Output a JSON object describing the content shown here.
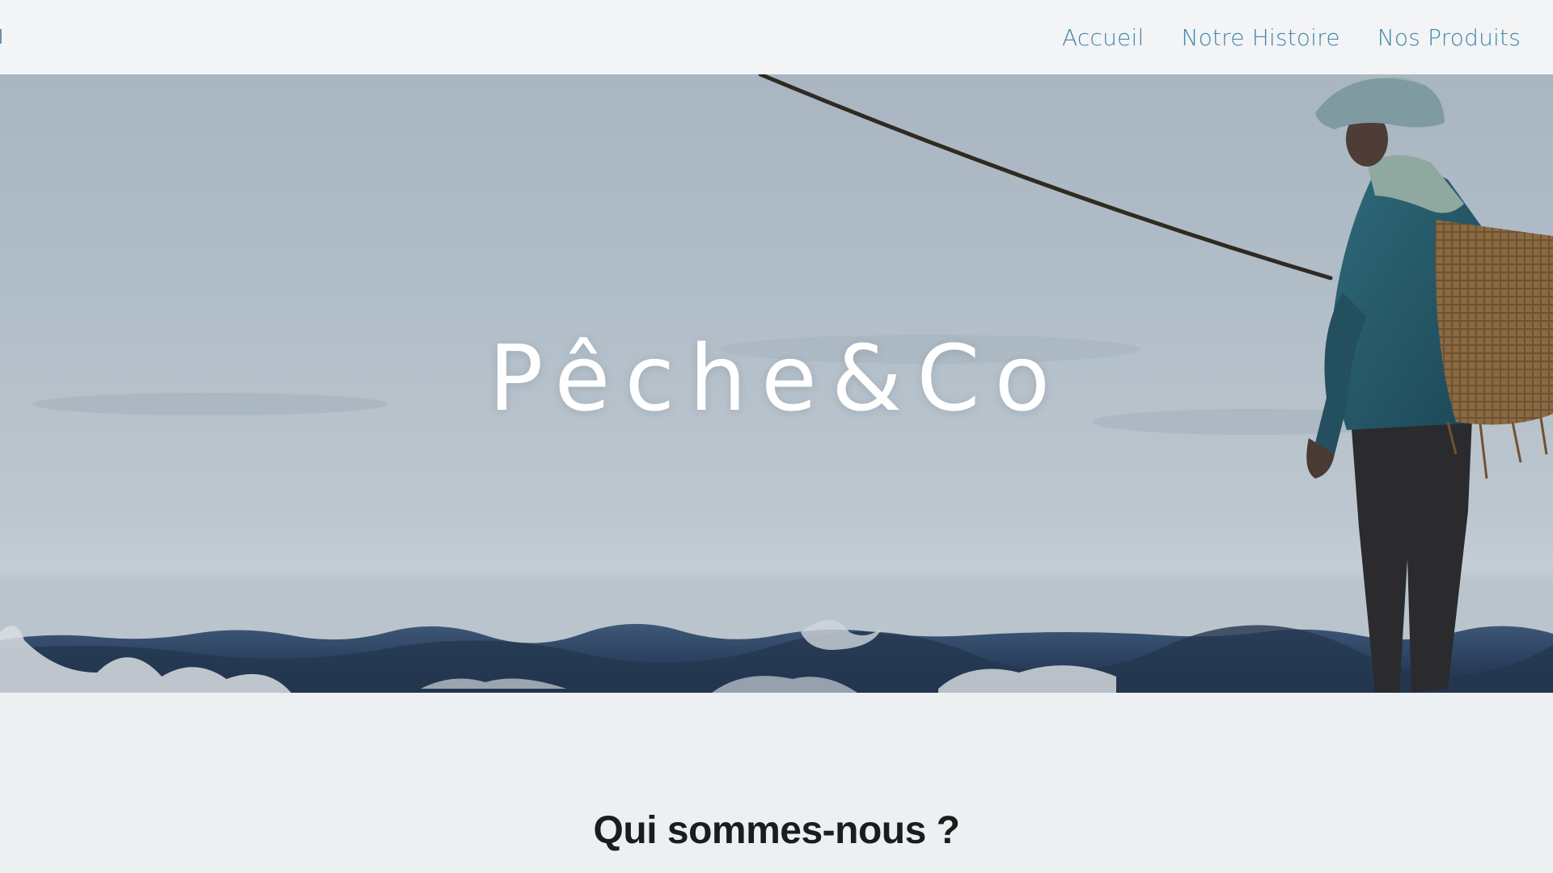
{
  "nav": {
    "links": [
      {
        "label": "Accueil"
      },
      {
        "label": "Notre Histoire"
      },
      {
        "label": "Nos Produits"
      }
    ]
  },
  "hero": {
    "title": "Pêche&Co",
    "image_subject": "fisherman-with-rod-and-basket-in-sea"
  },
  "about": {
    "title": "Qui sommes-nous ?"
  },
  "colors": {
    "nav_link": "#3e86a8",
    "nav_bg": "#f3f4f6",
    "page_bg": "#edf0f2",
    "hero_title": "#ffffff",
    "heading": "#1c1c1c"
  }
}
